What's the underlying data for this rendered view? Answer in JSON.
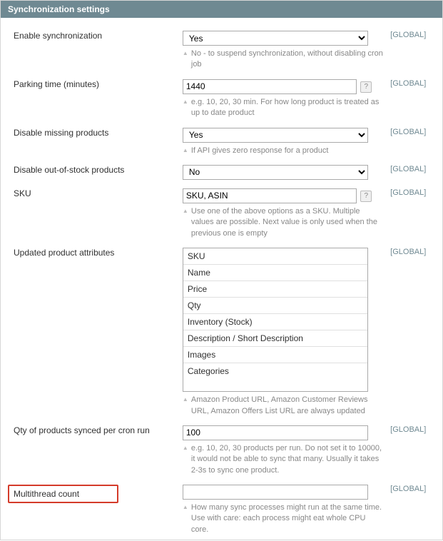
{
  "panel": {
    "title": "Synchronization settings"
  },
  "scope": {
    "global": "[GLOBAL]"
  },
  "fields": {
    "enable_sync": {
      "label": "Enable synchronization",
      "value": "Yes",
      "note": "No - to suspend synchronization, without disabling cron job"
    },
    "parking_time": {
      "label": "Parking time (minutes)",
      "value": "1440",
      "note": "e.g. 10, 20, 30 min. For how long product is treated as up to date product"
    },
    "disable_missing": {
      "label": "Disable missing products",
      "value": "Yes",
      "note": "If API gives zero response for a product"
    },
    "disable_oos": {
      "label": "Disable out-of-stock products",
      "value": "No"
    },
    "sku": {
      "label": "SKU",
      "value": "SKU, ASIN",
      "note": "Use one of the above options as a SKU. Multiple values are possible. Next value is only used when the previous one is empty"
    },
    "updated_attrs": {
      "label": "Updated product attributes",
      "options": [
        "SKU",
        "Name",
        "Price",
        "Qty",
        "Inventory (Stock)",
        "Description / Short Description",
        "Images",
        "Categories"
      ],
      "note": "Amazon Product URL, Amazon Customer Reviews URL, Amazon Offers List URL are always updated"
    },
    "qty_per_run": {
      "label": "Qty of products synced per cron run",
      "value": "100",
      "note": "e.g. 10, 20, 30 products per run. Do not set it to 10000, it would not be able to sync that many. Usually it takes 2-3s to sync one product."
    },
    "multithread": {
      "label": "Multithread count",
      "value": "",
      "note": "How many sync processes might run at the same time. Use with care: each process might eat whole CPU core."
    }
  },
  "help_glyph": "?"
}
